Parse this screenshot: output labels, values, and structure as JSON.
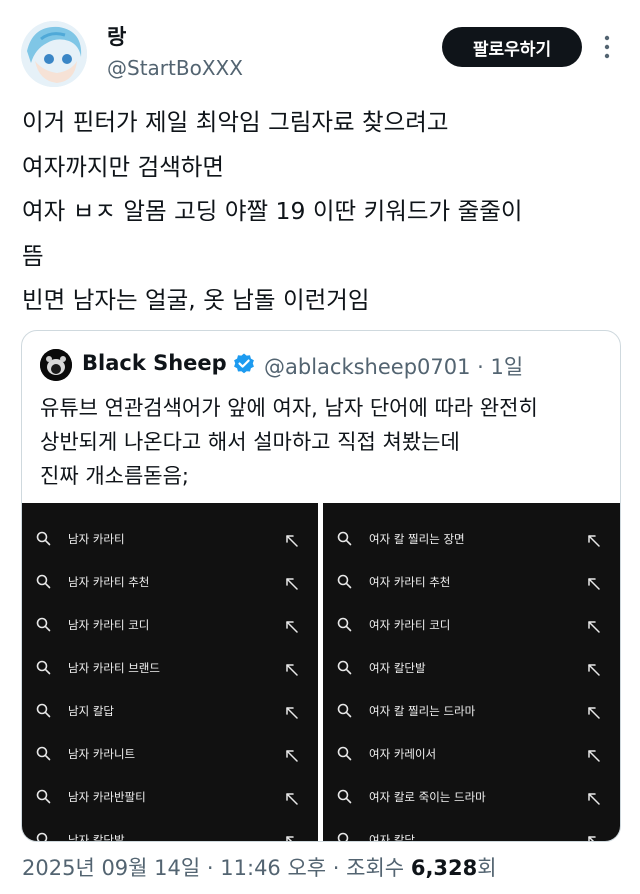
{
  "author": {
    "display_name": "랑",
    "handle": "@StartBoXXX",
    "follow_label": "팔로우하기"
  },
  "tweet": {
    "lines": [
      "이거 핀터가 제일 최악임 그림자료 찾으려고",
      "여자까지만 검색하면",
      "여자 ㅂㅈ 알몸 고딩 야짤 19 이딴 키워드가 줄줄이",
      "뜸",
      "빈면 남자는 얼굴, 옷 남돌 이런거임"
    ]
  },
  "quote": {
    "name": "Black Sheep",
    "handle": "@ablacksheep0701",
    "time": "1일",
    "text_lines": [
      "유튜브 연관검색어가 앞에 여자, 남자 단어에 따라 완전히",
      "상반되게 나온다고 해서 설마하고 직접 쳐봤는데",
      "진짜 개소름돋음;"
    ],
    "left_results": [
      "남자 카라티",
      "남자 카라티 추천",
      "남자 카라티 코디",
      "남자 카라티 브랜드",
      "남지 칼답",
      "남자 카라니트",
      "남자 카라반팔티",
      "남자 칼단발"
    ],
    "right_results": [
      "여자 칼 찔리는 장면",
      "여자 카라티 추천",
      "여자 카라티 코디",
      "여자 칼단발",
      "여자 칼 찔리는 드라마",
      "여자 카레이서",
      "여자 칼로 죽이는 드라마",
      "여자 칼답"
    ]
  },
  "footer": {
    "date": "2025년 09월 14일",
    "time": "11:46 오후",
    "views_label": "조회수",
    "views_count": "6,328",
    "views_suffix": "회"
  },
  "colors": {
    "text": "#0f1419",
    "secondary": "#536471",
    "verified": "#1d9bf0",
    "panel_bg": "#111111"
  },
  "icons": [
    "more-icon",
    "verified-badge-icon",
    "search-icon",
    "fill-arrow-icon"
  ]
}
